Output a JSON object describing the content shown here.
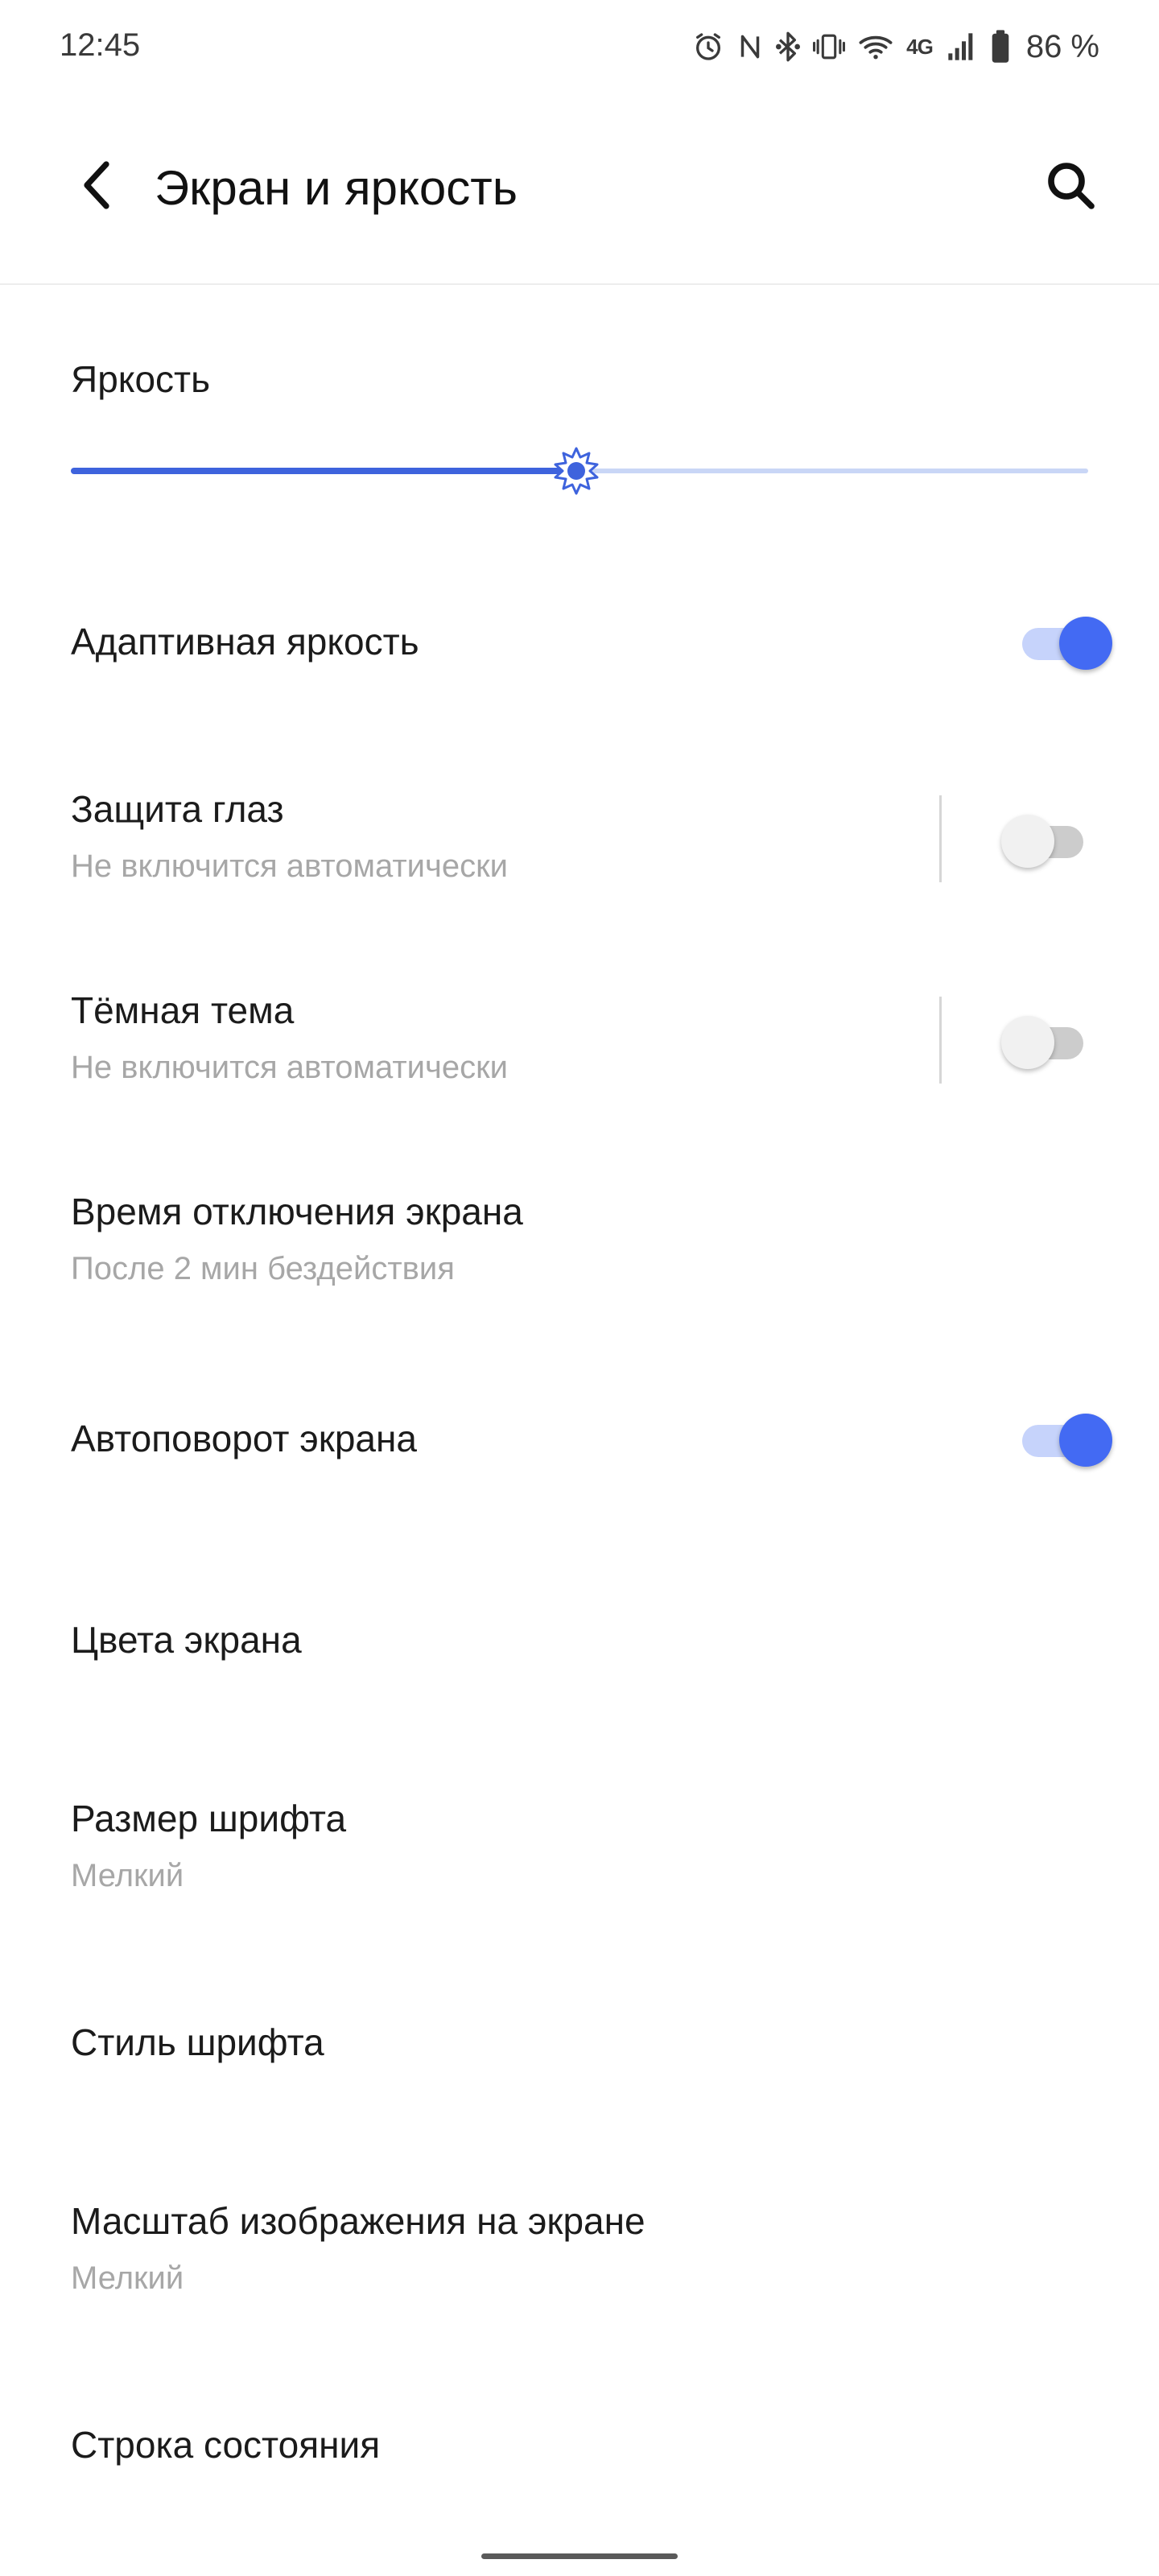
{
  "status_bar": {
    "time": "12:45",
    "icons": [
      "alarm-icon",
      "nfc-icon",
      "bluetooth-icon",
      "vibrate-icon",
      "wifi-icon",
      "network-4g-icon",
      "signal-icon",
      "battery-icon"
    ],
    "network_label": "4G",
    "battery_text": "86 %"
  },
  "header": {
    "title": "Экран и яркость",
    "back_icon": "chevron-left-icon",
    "search_icon": "search-icon"
  },
  "brightness": {
    "label": "Яркость",
    "level": 0.497,
    "accent_color": "#3e63dd",
    "track_color": "#c9d6f6",
    "thumb_icon": "brightness-sun-icon"
  },
  "settings": {
    "adaptive_brightness": {
      "title": "Адаптивная яркость",
      "enabled": true
    },
    "eye_protection": {
      "title": "Защита глаз",
      "subtitle": "Не включится автоматически",
      "enabled": false
    },
    "dark_theme": {
      "title": "Тёмная тема",
      "subtitle": "Не включится автоматически",
      "enabled": false
    },
    "screen_timeout": {
      "title": "Время отключения экрана",
      "subtitle": "После 2 мин бездействия"
    },
    "auto_rotate": {
      "title": "Автоповорот экрана",
      "enabled": true
    },
    "screen_colors": {
      "title": "Цвета экрана"
    },
    "font_size": {
      "title": "Размер шрифта",
      "subtitle": "Мелкий"
    },
    "font_style": {
      "title": "Стиль шрифта"
    },
    "display_scale": {
      "title": "Масштаб изображения на экране",
      "subtitle": "Мелкий"
    },
    "status_bar_setting": {
      "title": "Строка состояния"
    }
  },
  "colors": {
    "toggle_on_knob": "#436af3",
    "toggle_on_track": "#c6d3fb",
    "toggle_off_knob": "#f1f1f1",
    "toggle_off_track": "#cccccc",
    "subtitle": "#a7a7a7"
  }
}
